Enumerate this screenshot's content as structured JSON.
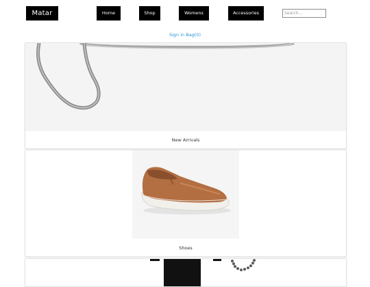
{
  "brand": {
    "logo_text": "Matar"
  },
  "nav": {
    "home": "Home",
    "shop": "Shop",
    "womens": "Womens",
    "accessories": "Accessories"
  },
  "search": {
    "placeholder": "Search..."
  },
  "account": {
    "sign_in": "Sign in",
    "bag": "Bag(0)"
  },
  "cards": [
    {
      "caption": "New Arrivals"
    },
    {
      "caption": "Shoes"
    }
  ],
  "colors": {
    "nav_background": "#000000",
    "nav_text": "#ffffff",
    "link": "#2a8fd6",
    "shoe_brown": "#b36f42",
    "sole_white": "#f2f0eb"
  }
}
